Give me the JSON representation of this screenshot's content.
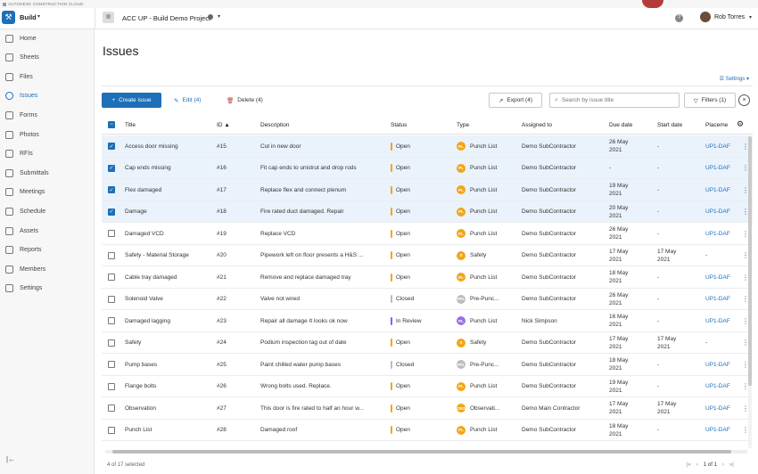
{
  "topstrip": "AUTODESK CONSTRUCTION CLOUD",
  "app": {
    "name": "Build"
  },
  "project": {
    "name": "ACC UP - Build Demo Project"
  },
  "user": {
    "name": "Rob Torres"
  },
  "sidebar": {
    "items": [
      {
        "label": "Home",
        "icon": "home-icon"
      },
      {
        "label": "Sheets",
        "icon": "sheets-icon"
      },
      {
        "label": "Files",
        "icon": "files-icon"
      },
      {
        "label": "Issues",
        "icon": "issues-icon",
        "active": true
      },
      {
        "label": "Forms",
        "icon": "forms-icon"
      },
      {
        "label": "Photos",
        "icon": "photos-icon"
      },
      {
        "label": "RFIs",
        "icon": "rfis-icon"
      },
      {
        "label": "Submittals",
        "icon": "submittals-icon"
      },
      {
        "label": "Meetings",
        "icon": "meetings-icon"
      },
      {
        "label": "Schedule",
        "icon": "schedule-icon"
      },
      {
        "label": "Assets",
        "icon": "assets-icon"
      },
      {
        "label": "Reports",
        "icon": "reports-icon"
      },
      {
        "label": "Members",
        "icon": "members-icon"
      },
      {
        "label": "Settings",
        "icon": "settings-icon"
      }
    ]
  },
  "page": {
    "title": "Issues",
    "settings_label": "Settings"
  },
  "toolbar": {
    "create": "Create issue",
    "edit": "Edit (4)",
    "delete": "Delete (4)",
    "export": "Export (4)",
    "search_placeholder": "Search by issue title",
    "filters": "Filters (1)"
  },
  "columns": [
    "Title",
    "ID",
    "Description",
    "Status",
    "Type",
    "Assigned to",
    "Due date",
    "Start date",
    "Placeme"
  ],
  "rows": [
    {
      "sel": true,
      "title": "Access door missing",
      "id": "#15",
      "desc": "Cut in new door",
      "status": "Open",
      "type": "Punch List",
      "badge": "PL",
      "assigned": "Demo SubContractor",
      "due": [
        "26 May",
        "2021"
      ],
      "start": [
        "-"
      ],
      "place": "UP1-DAF"
    },
    {
      "sel": true,
      "title": "Cap ends missing",
      "id": "#16",
      "desc": "Fit cap ends to unistrut and drop rods",
      "status": "Open",
      "type": "Punch List",
      "badge": "PL",
      "assigned": "Demo SubContractor",
      "due": [
        "-"
      ],
      "start": [
        "-"
      ],
      "place": "UP1-DAF"
    },
    {
      "sel": true,
      "title": "Flex damaged",
      "id": "#17",
      "desc": "Replace flex and connect plenum",
      "status": "Open",
      "type": "Punch List",
      "badge": "PL",
      "assigned": "Demo SubContractor",
      "due": [
        "19 May",
        "2021"
      ],
      "start": [
        "-"
      ],
      "place": "UP1-DAF"
    },
    {
      "sel": true,
      "title": "Damage",
      "id": "#18",
      "desc": "Fire rated duct damaged. Repair",
      "status": "Open",
      "type": "Punch List",
      "badge": "PL",
      "assigned": "Demo SubContractor",
      "due": [
        "20 May",
        "2021"
      ],
      "start": [
        "-"
      ],
      "place": "UP1-DAF"
    },
    {
      "sel": false,
      "title": "Damaged VCD",
      "id": "#19",
      "desc": "Replace VCD",
      "status": "Open",
      "type": "Punch List",
      "badge": "PL",
      "assigned": "Demo SubContractor",
      "due": [
        "26 May",
        "2021"
      ],
      "start": [
        "-"
      ],
      "place": "UP1-DAF"
    },
    {
      "sel": false,
      "title": "Safety - Material Storage",
      "id": "#20",
      "desc": "Pipework left on floor presents a H&S ...",
      "status": "Open",
      "type": "Safety",
      "badge": "S",
      "assigned": "Demo SubContractor",
      "due": [
        "17 May",
        "2021"
      ],
      "start": [
        "17 May",
        "2021"
      ],
      "place": "-"
    },
    {
      "sel": false,
      "title": "Cable tray damaged",
      "id": "#21",
      "desc": "Remove and replace damaged tray",
      "status": "Open",
      "type": "Punch List",
      "badge": "PL",
      "assigned": "Demo SubContractor",
      "due": [
        "18 May",
        "2021"
      ],
      "start": [
        "-"
      ],
      "place": "UP1-DAF"
    },
    {
      "sel": false,
      "title": "Solenoid Valve",
      "id": "#22",
      "desc": "Valve not wired",
      "status": "Closed",
      "type": "Pre-Punc...",
      "badge": "PPL",
      "assigned": "Demo SubContractor",
      "due": [
        "26 May",
        "2021"
      ],
      "start": [
        "-"
      ],
      "place": "UP1-DAF"
    },
    {
      "sel": false,
      "title": "Damaged lagging",
      "id": "#23",
      "desc": "Repair all damage It looks ok now",
      "status": "In Review",
      "type": "Punch List",
      "badge": "PL",
      "assigned": "Nick Simpson",
      "due": [
        "16 May",
        "2021"
      ],
      "start": [
        "-"
      ],
      "place": "UP1-DAF"
    },
    {
      "sel": false,
      "title": "Safety",
      "id": "#24",
      "desc": "Podium inspection tag out of date",
      "status": "Open",
      "type": "Safety",
      "badge": "S",
      "assigned": "Demo SubContractor",
      "due": [
        "17 May",
        "2021"
      ],
      "start": [
        "17 May",
        "2021"
      ],
      "place": "-"
    },
    {
      "sel": false,
      "title": "Pump bases",
      "id": "#25",
      "desc": "Paint chilled water pump bases",
      "status": "Closed",
      "type": "Pre-Punc...",
      "badge": "PPL",
      "assigned": "Demo SubContractor",
      "due": [
        "18 May",
        "2021"
      ],
      "start": [
        "-"
      ],
      "place": "UP1-DAF"
    },
    {
      "sel": false,
      "title": "Flange bolts",
      "id": "#26",
      "desc": "Wrong bolts used. Replace.",
      "status": "Open",
      "type": "Punch List",
      "badge": "PL",
      "assigned": "Demo SubContractor",
      "due": [
        "19 May",
        "2021"
      ],
      "start": [
        "-"
      ],
      "place": "UP1-DAF"
    },
    {
      "sel": false,
      "title": "Observation",
      "id": "#27",
      "desc": "This door is fire rated to half an hour w...",
      "status": "Open",
      "type": "Observati...",
      "badge": "OBS",
      "assigned": "Demo Main Contractor",
      "due": [
        "17 May",
        "2021"
      ],
      "start": [
        "17 May",
        "2021"
      ],
      "place": "UP1-DAF"
    },
    {
      "sel": false,
      "title": "Punch List",
      "id": "#28",
      "desc": "Damaged roof",
      "status": "Open",
      "type": "Punch List",
      "badge": "PL",
      "assigned": "Demo SubContractor",
      "due": [
        "18 May",
        "2021"
      ],
      "start": [
        "-"
      ],
      "place": "UP1-DAF"
    }
  ],
  "colors": {
    "accent": "#1d6fb8",
    "status": {
      "Open": "#f2a516",
      "Closed": "#bdbdbd",
      "In Review": "#8b5cf6"
    },
    "badge": {
      "PL": "#f2a516",
      "S": "#f2a516",
      "PPL": "#bdbdbd",
      "OBS": "#f2a516",
      "PL-review": "#9a6ee8"
    }
  },
  "footer": {
    "selected": "4 of 17 selected",
    "page": "1 of 1"
  }
}
